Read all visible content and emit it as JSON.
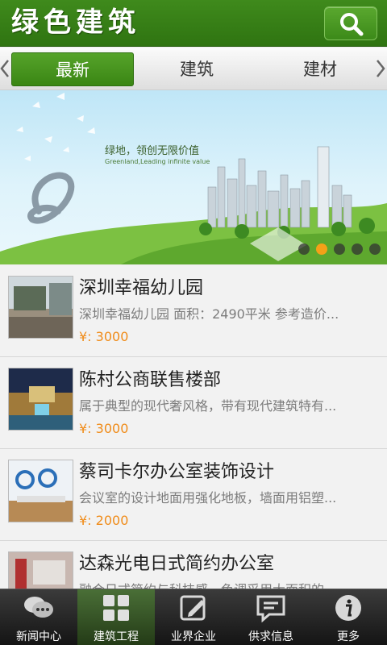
{
  "header": {
    "title": "绿色建筑",
    "search_icon": "search-icon"
  },
  "tabs": [
    {
      "label": "最新",
      "active": true
    },
    {
      "label": "建筑",
      "active": false
    },
    {
      "label": "建材",
      "active": false
    }
  ],
  "banner": {
    "caption": "绿地，领创无限价值",
    "subcaption": "Greenland,Leading infinite value",
    "slide_count": 5,
    "active_slide": 1
  },
  "list": [
    {
      "title": "深圳幸福幼儿园",
      "desc": "深圳幸福幼儿园 面积：2490平米 参考造价...",
      "price": "¥: 3000"
    },
    {
      "title": "陈村公商联售楼部",
      "desc": "属于典型的现代奢风格，带有现代建筑特有...",
      "price": "¥: 3000"
    },
    {
      "title": "蔡司卡尔办公室装饰设计",
      "desc": "会议室的设计地面用强化地板，墙面用铝塑...",
      "price": "¥: 2000"
    },
    {
      "title": "达森光电日式简约办公室",
      "desc": "融合日式简约与科技感，色调采用大面积的...",
      "price": ""
    }
  ],
  "bottom_nav": [
    {
      "label": "新闻中心",
      "icon": "chat-bubbles-icon"
    },
    {
      "label": "建筑工程",
      "icon": "grid-icon",
      "active": true
    },
    {
      "label": "业界企业",
      "icon": "edit-icon"
    },
    {
      "label": "供求信息",
      "icon": "message-icon"
    },
    {
      "label": "更多",
      "icon": "info-icon"
    }
  ],
  "colors": {
    "brand_green": "#3a8614",
    "price_orange": "#f08c1a",
    "nav_dark": "#1e1e1e"
  }
}
